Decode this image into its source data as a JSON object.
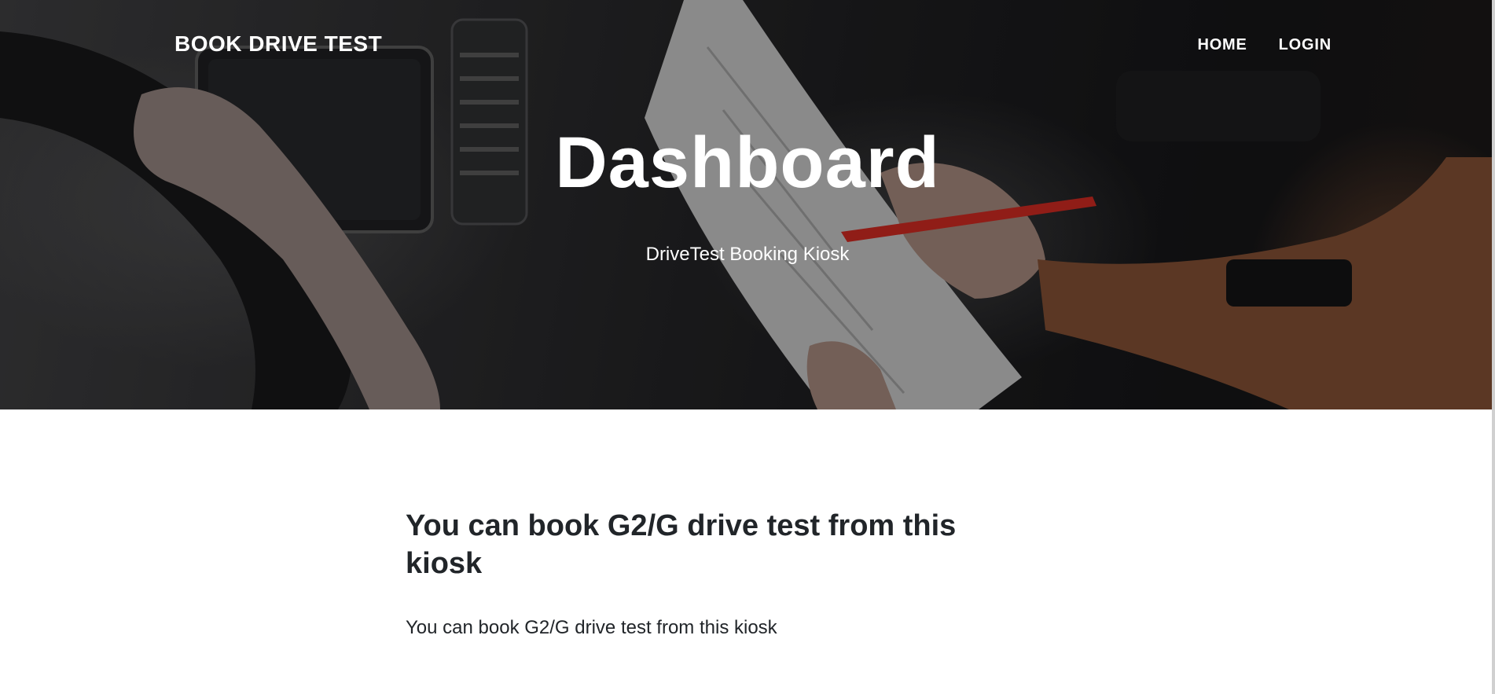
{
  "header": {
    "brand": "BOOK DRIVE TEST",
    "nav": [
      {
        "label": "HOME"
      },
      {
        "label": "LOGIN"
      }
    ]
  },
  "hero": {
    "title": "Dashboard",
    "subtitle": "DriveTest Booking Kiosk",
    "background_description": "darkened photo of a car interior with a hand on the steering wheel and another hand holding a test form and red pen"
  },
  "main": {
    "heading": "You can book G2/G drive test from this kiosk",
    "body": "You can book G2/G drive test from this kiosk"
  },
  "colors": {
    "text_dark": "#212529",
    "hero_text": "#ffffff",
    "pen_red": "#c0271f"
  }
}
